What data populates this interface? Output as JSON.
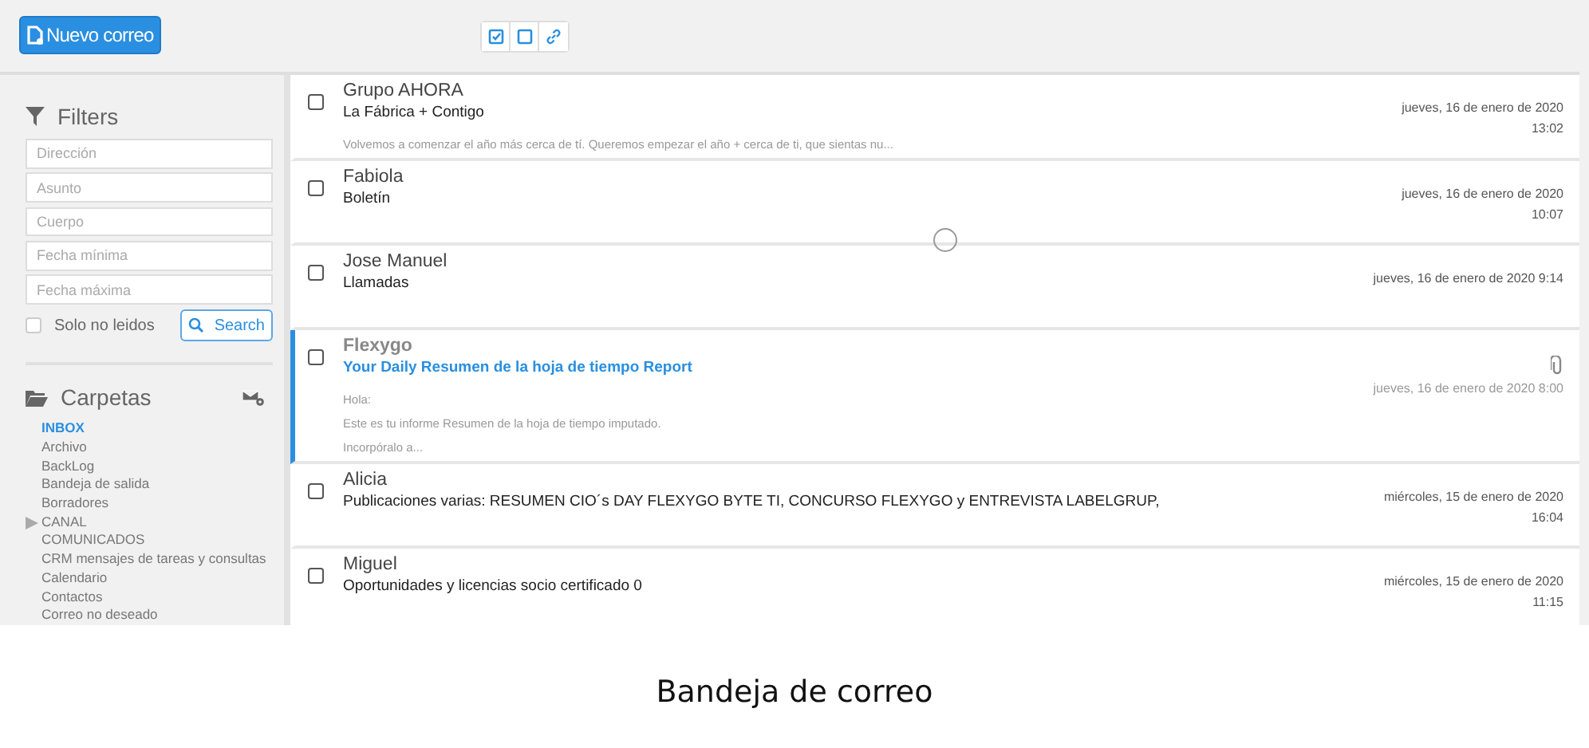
{
  "toolbar": {
    "new_button": "Nuevo correo"
  },
  "filters": {
    "title": "Filters",
    "fields": [
      {
        "placeholder": "Dirección"
      },
      {
        "placeholder": "Asunto"
      },
      {
        "placeholder": "Cuerpo"
      },
      {
        "placeholder": "Fecha mínima"
      },
      {
        "placeholder": "Fecha máxima"
      }
    ],
    "unread_only": {
      "label": "Solo no leidos",
      "checked": false
    },
    "search_button": "Search"
  },
  "folders": {
    "title": "Carpetas",
    "items": [
      {
        "label": "INBOX",
        "selected": true,
        "collapsed": false
      },
      {
        "label": "Archivo",
        "selected": false,
        "collapsed": false
      },
      {
        "label": "BackLog",
        "selected": false,
        "collapsed": false
      },
      {
        "label": "Bandeja de salida",
        "selected": false,
        "collapsed": false
      },
      {
        "label": "Borradores",
        "selected": false,
        "collapsed": false
      },
      {
        "label": "CANAL",
        "selected": false,
        "collapsed": true
      },
      {
        "label": "COMUNICADOS",
        "selected": false,
        "collapsed": false
      },
      {
        "label": "CRM mensajes de tareas y consultas",
        "selected": false,
        "collapsed": false
      },
      {
        "label": "Calendario",
        "selected": false,
        "collapsed": false
      },
      {
        "label": "Contactos",
        "selected": false,
        "collapsed": false
      },
      {
        "label": "Correo no deseado",
        "selected": false,
        "collapsed": false
      }
    ]
  },
  "messages": [
    {
      "sender": "Grupo AHORA",
      "subject": "La Fábrica + Contigo",
      "preview": [
        "Volvemos a comenzar el año más cerca de tí. Queremos empezar el año + cerca de ti, que sientas nu..."
      ],
      "date_lines": [
        "jueves, 16 de enero de 2020",
        "13:02"
      ],
      "checked": false,
      "selected": false,
      "read": false,
      "attachment": false
    },
    {
      "sender": "Fabiola",
      "subject": "Boletín",
      "date_lines": [
        "jueves, 16 de enero de 2020",
        "10:07"
      ],
      "checked": false,
      "selected": false,
      "read": false,
      "attachment": false
    },
    {
      "sender": "Jose Manuel",
      "subject": "Llamadas",
      "date_lines": [
        "jueves, 16 de enero de 2020 9:14"
      ],
      "checked": false,
      "selected": false,
      "read": false,
      "attachment": false
    },
    {
      "sender": "Flexygo",
      "subject": "Your Daily Resumen de la hoja de tiempo Report",
      "preview": [
        "Hola:",
        "Este es tu informe Resumen de la hoja de tiempo imputado.",
        "Incorpóralo a..."
      ],
      "date_lines": [
        "jueves, 16 de enero de 2020 8:00"
      ],
      "checked": false,
      "selected": true,
      "read": true,
      "attachment": true
    },
    {
      "sender": "Alicia",
      "subject": "Publicaciones varias: RESUMEN CIO´s DAY FLEXYGO BYTE TI, CONCURSO FLEXYGO y ENTREVISTA LABELGRUP,",
      "date_lines": [
        "miércoles, 15 de enero de 2020",
        "16:04"
      ],
      "checked": false,
      "selected": false,
      "read": false,
      "attachment": false
    },
    {
      "sender": "Miguel",
      "subject": "Oportunidades y licencias socio certificado 0",
      "date_lines": [
        "miércoles, 15 de enero de 2020",
        "11:15"
      ],
      "checked": false,
      "selected": false,
      "read": false,
      "attachment": false
    }
  ],
  "caption": "Bandeja de correo"
}
